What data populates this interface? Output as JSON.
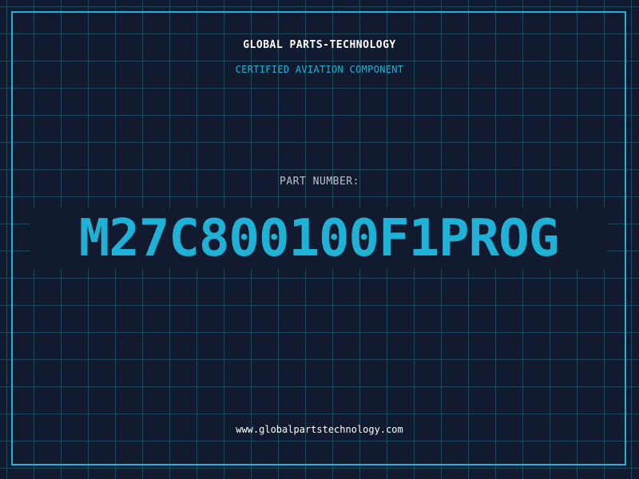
{
  "header": {
    "company": "GLOBAL PARTS-TECHNOLOGY",
    "tagline": "CERTIFIED AVIATION COMPONENT"
  },
  "part": {
    "label": "PART NUMBER:",
    "number": "M27C800100F1PROG"
  },
  "footer": {
    "url": "www.globalpartstechnology.com"
  },
  "colors": {
    "background": "#111a2e",
    "grid_line": "#1d4a5e",
    "accent": "#1fb2d6",
    "text_primary": "#ffffff",
    "text_muted": "#b9c3cf"
  }
}
